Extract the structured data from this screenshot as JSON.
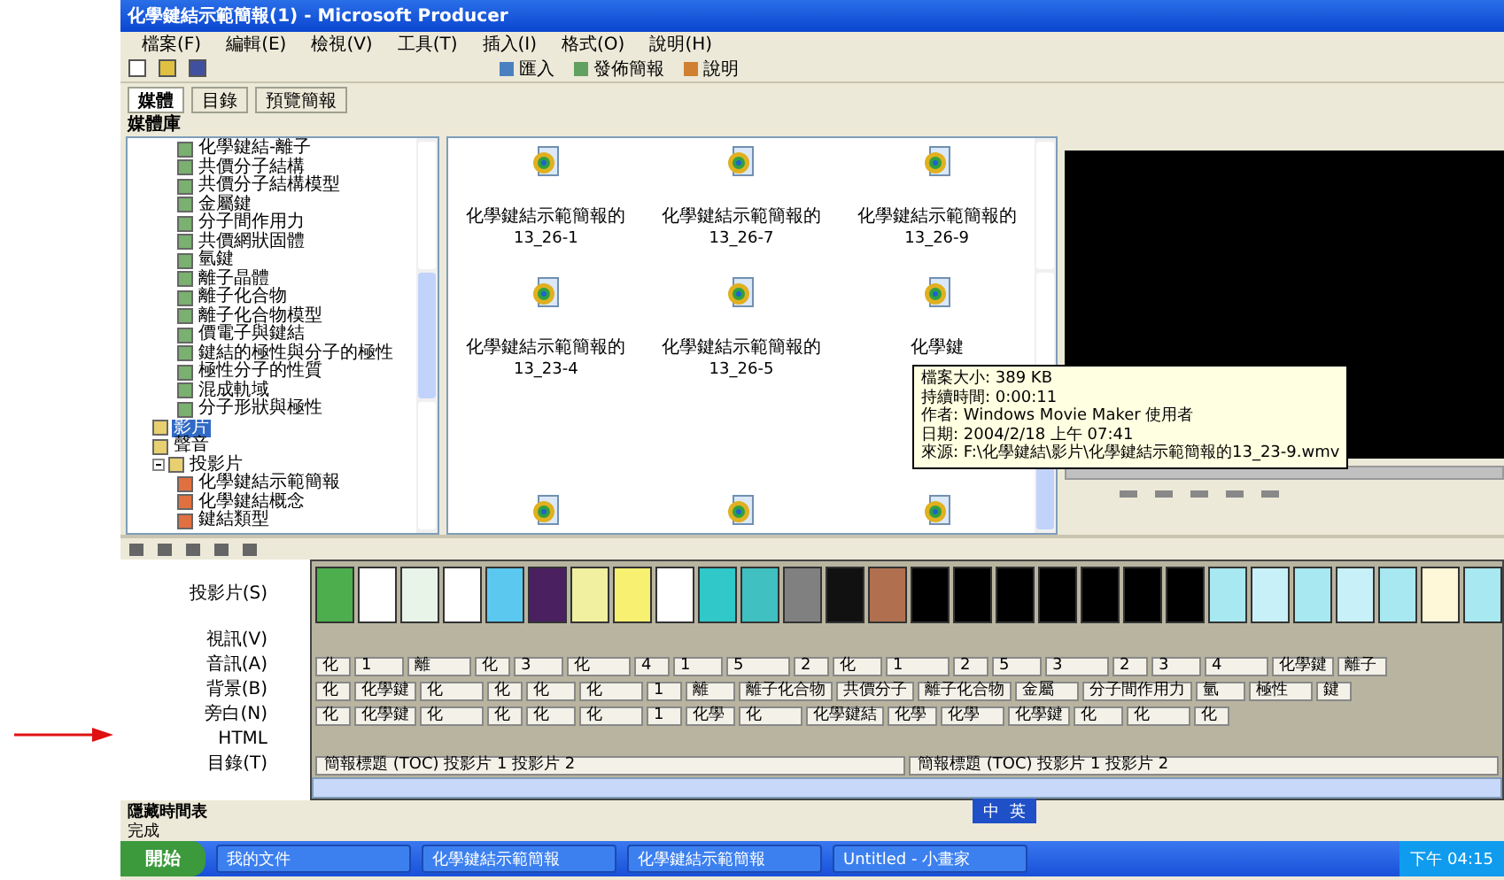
{
  "window": {
    "title": "化學鍵結示範簡報(1) - Microsoft Producer"
  },
  "menu": [
    "檔案(F)",
    "編輯(E)",
    "檢視(V)",
    "工具(T)",
    "插入(I)",
    "格式(O)",
    "說明(H)"
  ],
  "toolbar": [
    "匯入",
    "發佈簡報",
    "說明"
  ],
  "tabs": [
    {
      "label": "媒體",
      "selected": true
    },
    {
      "label": "目錄",
      "selected": false
    },
    {
      "label": "預覽簡報",
      "selected": false
    }
  ],
  "media_pane": {
    "title": "媒體庫"
  },
  "tree": [
    {
      "children": [
        {
          "label": "化學鍵結-離子",
          "kind": "clip",
          "selected": false
        },
        {
          "label": "共價分子結構",
          "kind": "clip",
          "selected": false
        },
        {
          "label": "共價分子結構模型",
          "kind": "clip",
          "selected": false
        },
        {
          "label": "金屬鍵",
          "kind": "clip",
          "selected": false
        },
        {
          "label": "分子間作用力",
          "kind": "clip",
          "selected": false
        },
        {
          "label": "共價網狀固體",
          "kind": "clip",
          "selected": false
        },
        {
          "label": "氫鍵",
          "kind": "clip",
          "selected": false
        },
        {
          "label": "離子晶體",
          "kind": "clip",
          "selected": false
        },
        {
          "label": "離子化合物",
          "kind": "clip",
          "selected": false
        },
        {
          "label": "離子化合物模型",
          "kind": "clip",
          "selected": false
        },
        {
          "label": "價電子與鍵結",
          "kind": "clip",
          "selected": false
        },
        {
          "label": "鍵結的極性與分子的極性",
          "kind": "clip",
          "selected": false
        },
        {
          "label": "極性分子的性質",
          "kind": "clip",
          "selected": false
        },
        {
          "label": "混成軌域",
          "kind": "clip",
          "selected": false
        },
        {
          "label": "分子形狀與極性",
          "kind": "clip",
          "selected": false
        }
      ]
    },
    {
      "label": "影片",
      "kind": "folder",
      "selected": true
    },
    {
      "label": "聲音",
      "kind": "folder",
      "selected": false
    },
    {
      "label": "投影片",
      "kind": "folder",
      "selected": false,
      "expanded": true,
      "children": [
        {
          "label": "化學鍵結示範簡報",
          "kind": "slide",
          "selected": false
        },
        {
          "label": "化學鍵結概念",
          "kind": "slide",
          "selected": false
        },
        {
          "label": "鍵結類型",
          "kind": "slide",
          "selected": false
        }
      ]
    }
  ],
  "thumbnails": [
    {
      "label": "化學鍵結示範簡報的",
      "sub": "13_26-1"
    },
    {
      "label": "化學鍵結示範簡報的",
      "sub": "13_26-7"
    },
    {
      "label": "化學鍵結示範簡報的",
      "sub": "13_26-9"
    },
    {
      "label": "化學鍵結示範簡報的",
      "sub": "13_23-4"
    },
    {
      "label": "化學鍵結示範簡報的",
      "sub": "13_26-5"
    },
    {
      "label": "化學鍵"
    },
    {
      "kind": "file"
    },
    {
      "kind": "file"
    },
    {
      "kind": "file"
    }
  ],
  "tooltip": [
    "檔案大小: 389 KB",
    "持續時間: 0:00:11",
    "作者: Windows Movie Maker 使用者",
    "日期: 2004/2/18 上午 07:41",
    "來源: F:\\化學鍵結\\影片\\化學鍵結示範簡報的13_23-9.wmv"
  ],
  "timeline": {
    "tracks": [
      {
        "label": "投影片(S)",
        "kind": "slides",
        "slides": [
          {
            "color": "#4cae4c"
          },
          {
            "color": "#ffffff"
          },
          {
            "color": "#e8f4e8"
          },
          {
            "color": "#ffffff"
          },
          {
            "color": "#5bc8f0"
          },
          {
            "color": "#4a2060"
          },
          {
            "color": "#f0f0a0"
          },
          {
            "color": "#f8f070"
          },
          {
            "color": "#ffffff"
          },
          {
            "color": "#30c8c8"
          },
          {
            "color": "#40c0c0"
          },
          {
            "color": "#808080"
          },
          {
            "color": "#111111"
          },
          {
            "color": "#b07050"
          },
          {
            "color": "#000000"
          },
          {
            "color": "#000000"
          },
          {
            "color": "#000000"
          },
          {
            "color": "#000000"
          },
          {
            "color": "#000000"
          },
          {
            "color": "#000000"
          },
          {
            "color": "#000000"
          },
          {
            "color": "#a8e8f0"
          },
          {
            "color": "#c8f0f8"
          },
          {
            "color": "#a8e8f0"
          },
          {
            "color": "#c8f0f8"
          },
          {
            "color": "#a8e8f0"
          },
          {
            "color": "#fff8d8"
          },
          {
            "color": "#a8e8f0"
          }
        ]
      },
      {
        "label": "視訊(V)",
        "kind": "empty"
      },
      {
        "label": "音訊(A)",
        "kind": "clips",
        "clips": [
          "化",
          "1",
          "離",
          "化",
          "3",
          "化",
          "4",
          "1",
          "5",
          "2",
          "化",
          "1",
          "2",
          "5",
          "3",
          "2",
          "3",
          "4",
          "化學鍵",
          "離子"
        ]
      },
      {
        "label": "背景(B)",
        "kind": "clips",
        "clips": [
          "化",
          "化學鍵",
          "化",
          "化",
          "化",
          "化",
          "1",
          "離",
          "離子化合物",
          "共價分子",
          "離子化合物",
          "金屬",
          "分子間作用力",
          "氫",
          "極性",
          "鍵"
        ]
      },
      {
        "label": "旁白(N)",
        "kind": "clips",
        "clips": [
          "化",
          "化學鍵",
          "化",
          "化",
          "化",
          "化",
          "1",
          "化學",
          "化",
          "化學鍵結",
          "化學",
          "化學",
          "化學鍵",
          "化",
          "化",
          "化"
        ]
      },
      {
        "label": "HTML",
        "kind": "empty"
      },
      {
        "label": "目錄(T)",
        "kind": "toc",
        "toc": [
          "簡報標題 (TOC) 投影片 1 投影片 2",
          "簡報標題 (TOC) 投影片 1 投影片 2"
        ]
      }
    ]
  },
  "hide_timeline": "隱藏時間表",
  "status": "完成",
  "language_bar": [
    "中",
    "英"
  ],
  "taskbar": {
    "start": "開始",
    "tasks": [
      "我的文件",
      "化學鍵結示範簡報",
      "化學鍵結示範簡報",
      "Untitled - 小畫家"
    ],
    "clock": "下午 04:15"
  }
}
